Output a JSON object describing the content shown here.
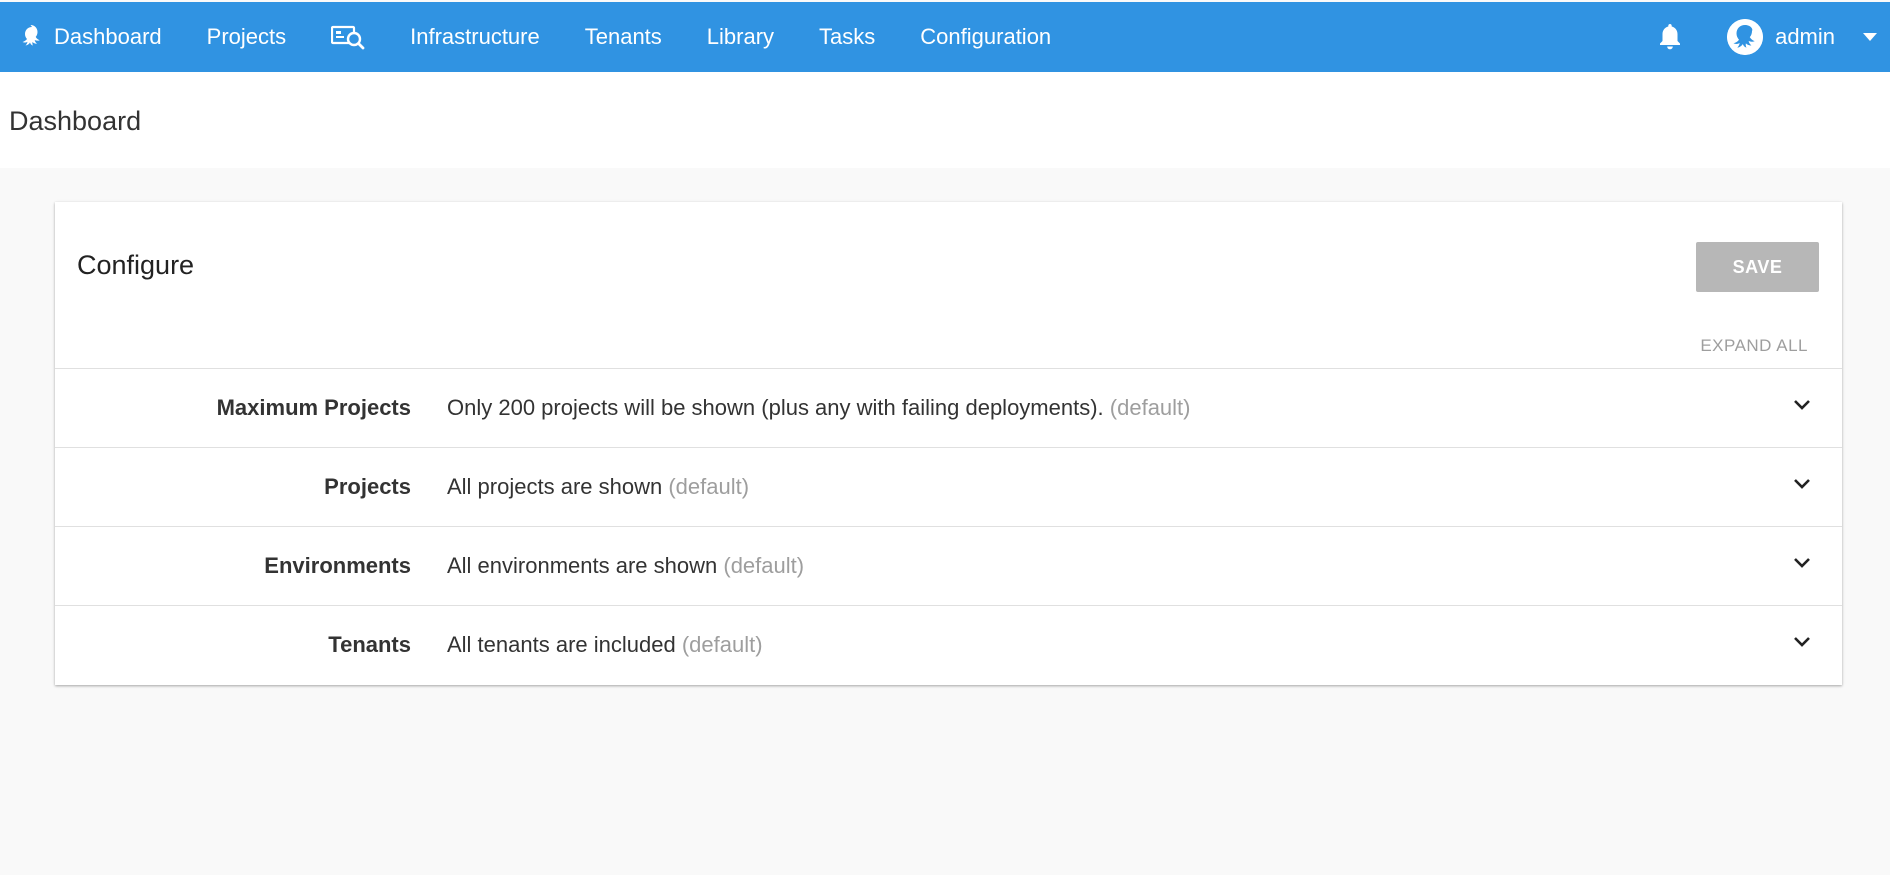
{
  "nav": {
    "logo_label": "Dashboard",
    "links": [
      "Projects",
      "Infrastructure",
      "Tenants",
      "Library",
      "Tasks",
      "Configuration"
    ],
    "user_name": "admin",
    "colors": {
      "bar": "#3093e2"
    }
  },
  "page": {
    "title": "Dashboard"
  },
  "card": {
    "title": "Configure",
    "save_label": "SAVE",
    "expand_all_label": "EXPAND ALL",
    "rows": [
      {
        "label": "Maximum Projects",
        "value": "Only 200 projects will be shown (plus any with failing deployments).",
        "default": "(default)"
      },
      {
        "label": "Projects",
        "value": "All projects are shown",
        "default": "(default)"
      },
      {
        "label": "Environments",
        "value": "All environments are shown",
        "default": "(default)"
      },
      {
        "label": "Tenants",
        "value": "All tenants are included",
        "default": "(default)"
      }
    ]
  },
  "icons": {
    "logo": "octopus-icon",
    "search": "machine-search-icon",
    "bell": "bell-icon",
    "avatar": "user-avatar-icon",
    "dropdown": "caret-down-icon",
    "expand": "chevron-down-icon"
  }
}
